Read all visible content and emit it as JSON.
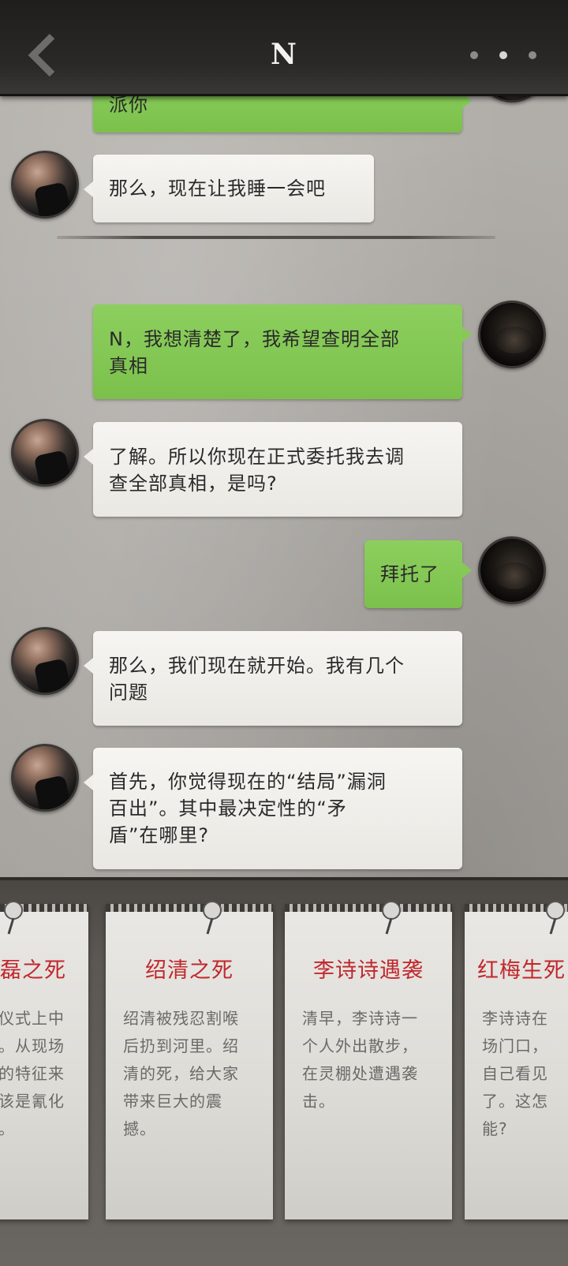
{
  "header": {
    "title": "N"
  },
  "chat": {
    "messages": [
      {
        "side": "right",
        "lines": [
          "派你"
        ]
      },
      {
        "side": "left",
        "lines": [
          "那么，现在让我睡一会吧"
        ]
      },
      {
        "side": "right",
        "lines": [
          "N，我想清楚了，我希望查明全部",
          "真相"
        ]
      },
      {
        "side": "left",
        "lines": [
          "了解。所以你现在正式委托我去调",
          "查全部真相，是吗?"
        ]
      },
      {
        "side": "right",
        "lines": [
          "拜托了"
        ]
      },
      {
        "side": "left",
        "lines": [
          "那么，我们现在就开始。我有几个",
          "问题"
        ]
      },
      {
        "side": "left",
        "lines": [
          "首先，你觉得现在的“结局”漏洞",
          "百出”。其中最决定性的“矛",
          "盾”在哪里?"
        ]
      }
    ]
  },
  "cards": [
    {
      "title": "磊之死",
      "lines": [
        "仪式上中",
        "。从现场",
        "的特征来",
        "该是氰化",
        "。"
      ]
    },
    {
      "title": "绍清之死",
      "lines": [
        "绍清被残忍割喉",
        "后扔到河里。绍",
        "清的死，给大家",
        "带来巨大的震",
        "撼。"
      ]
    },
    {
      "title": "李诗诗遇袭",
      "lines": [
        "清早，李诗诗一",
        "个人外出散步，",
        "在灵棚处遭遇袭",
        "击。"
      ]
    },
    {
      "title": "红梅生死",
      "lines": [
        "李诗诗在",
        "场门口，",
        "自己看见",
        "了。这怎",
        "能?"
      ]
    }
  ]
}
